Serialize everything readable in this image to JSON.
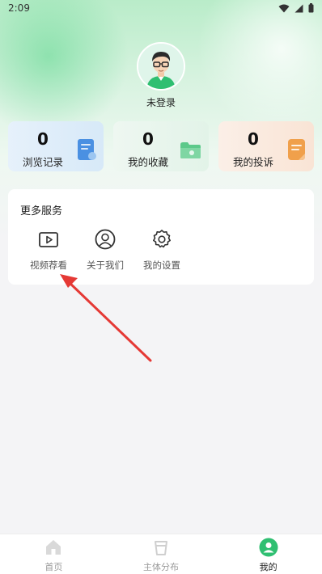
{
  "status_bar": {
    "time": "2:09"
  },
  "profile": {
    "login_label": "未登录"
  },
  "stats": [
    {
      "value": "0",
      "label": "浏览记录",
      "color": "#4a90e2"
    },
    {
      "value": "0",
      "label": "我的收藏",
      "color": "#5cc98a"
    },
    {
      "value": "0",
      "label": "我的投诉",
      "color": "#f0a04b"
    }
  ],
  "services": {
    "title": "更多服务",
    "items": [
      {
        "label": "视频荐看",
        "icon": "video-icon"
      },
      {
        "label": "关于我们",
        "icon": "user-circle-icon"
      },
      {
        "label": "我的设置",
        "icon": "gear-icon"
      }
    ]
  },
  "tabbar": {
    "items": [
      {
        "label": "首页",
        "icon": "home-icon"
      },
      {
        "label": "主体分布",
        "icon": "cup-icon"
      },
      {
        "label": "我的",
        "icon": "profile-icon",
        "active": true
      }
    ]
  },
  "colors": {
    "accent": "#2fbf71",
    "arrow": "#e53935"
  }
}
